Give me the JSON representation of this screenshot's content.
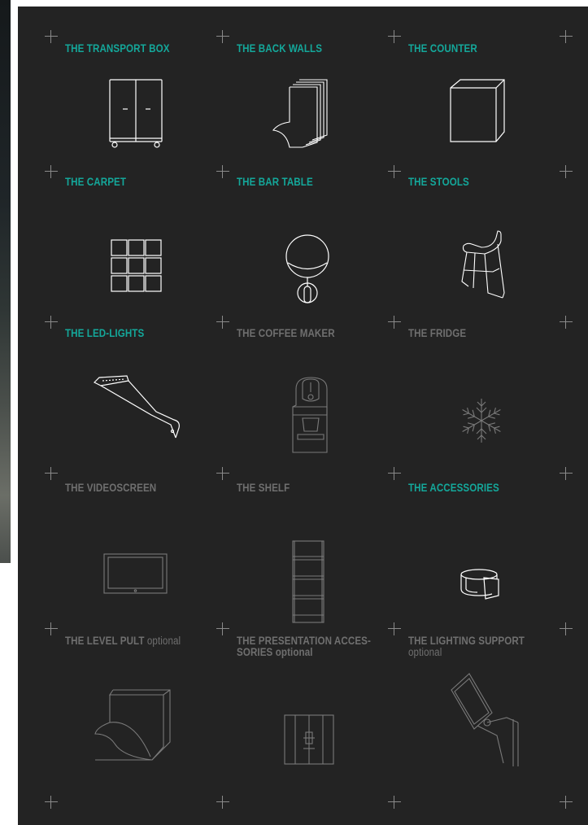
{
  "items": [
    {
      "title": "THE TRANSPORT BOX",
      "optional": "",
      "icon": "transport-box-icon",
      "active": true
    },
    {
      "title": "THE BACK WALLS",
      "optional": "",
      "icon": "back-walls-icon",
      "active": true
    },
    {
      "title": "THE COUNTER",
      "optional": "",
      "icon": "counter-icon",
      "active": true
    },
    {
      "title": "THE CARPET",
      "optional": "",
      "icon": "carpet-icon",
      "active": true
    },
    {
      "title": "THE BAR TABLE",
      "optional": "",
      "icon": "bar-table-icon",
      "active": true
    },
    {
      "title": "THE STOOLS",
      "optional": "",
      "icon": "stools-icon",
      "active": true
    },
    {
      "title": "THE LED-LIGHTS",
      "optional": "",
      "icon": "led-lights-icon",
      "active": true
    },
    {
      "title": "THE COFFEE MAKER",
      "optional": "",
      "icon": "coffee-maker-icon",
      "active": false
    },
    {
      "title": "THE FRIDGE",
      "optional": "",
      "icon": "snowflake-icon",
      "active": false
    },
    {
      "title": "THE VIDEOSCREEN",
      "optional": "",
      "icon": "videoscreen-icon",
      "active": false
    },
    {
      "title": "THE SHELF",
      "optional": "",
      "icon": "shelf-icon",
      "active": false
    },
    {
      "title": "THE ACCESSORIES",
      "optional": "",
      "icon": "accessories-icon",
      "active": true
    },
    {
      "title": "THE LEVEL PULT",
      "optional": "optional",
      "icon": "level-pult-icon",
      "active": false
    },
    {
      "title": "THE PRESENTATION ACCES-",
      "title2": "SORIES",
      "optional": "optional",
      "icon": "presentation-accessories-icon",
      "active": false
    },
    {
      "title": "THE LIGHTING SUPPORT",
      "optional": "optional",
      "icon": "lighting-support-icon",
      "active": false
    }
  ],
  "colors": {
    "panel": "#232323",
    "active": "#14a79a",
    "inactive": "#6f6f6f",
    "cross": "#8a8a8a"
  }
}
